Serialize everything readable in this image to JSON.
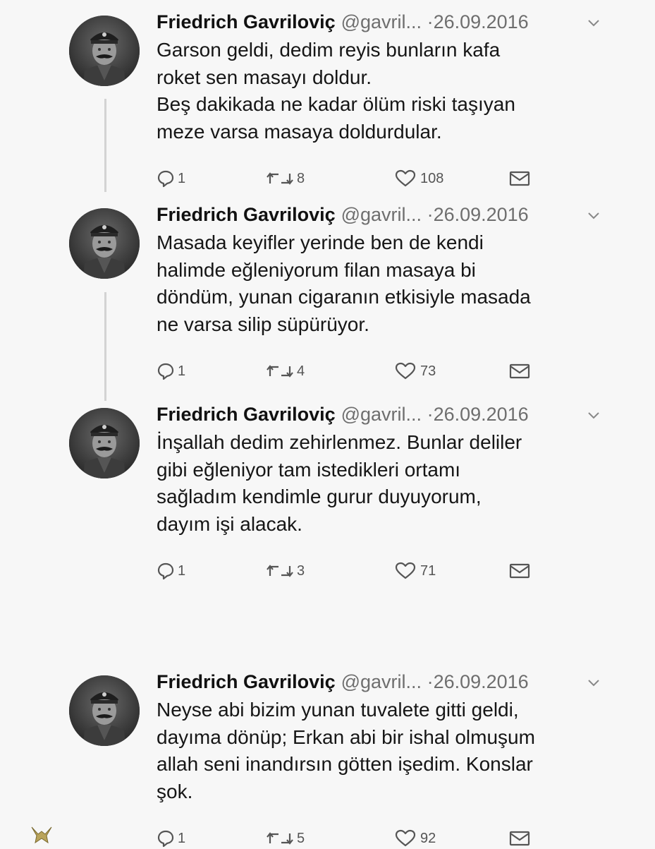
{
  "tweets": [
    {
      "author": "Friedrich Gavriloviç",
      "handle": "@gavril...",
      "separator": "·",
      "date": "26.09.2016",
      "lines": [
        "Garson geldi, dedim reyis bunların kafa",
        "roket sen masayı doldur.",
        "Beş dakikada ne kadar ölüm riski taşıyan",
        "meze varsa masaya doldurdular."
      ],
      "replies": "1",
      "retweets": "8",
      "likes": "108"
    },
    {
      "author": "Friedrich Gavriloviç",
      "handle": "@gavril...",
      "separator": "·",
      "date": "26.09.2016",
      "lines": [
        "Masada keyifler yerinde ben de kendi",
        "halimde eğleniyorum filan masaya bi",
        "döndüm, yunan cigaranın etkisiyle masada",
        "ne varsa silip süpürüyor."
      ],
      "replies": "1",
      "retweets": "4",
      "likes": "73"
    },
    {
      "author": "Friedrich Gavriloviç",
      "handle": "@gavril...",
      "separator": "·",
      "date": "26.09.2016",
      "lines": [
        "İnşallah dedim zehirlenmez. Bunlar deliler",
        "gibi eğleniyor tam istedikleri ortamı",
        "sağladım kendimle gurur duyuyorum,",
        "dayım işi alacak."
      ],
      "replies": "1",
      "retweets": "3",
      "likes": "71"
    },
    {
      "author": "Friedrich Gavriloviç",
      "handle": "@gavril...",
      "separator": "·",
      "date": "26.09.2016",
      "lines": [
        "Neyse abi bizim yunan tuvalete gitti geldi,",
        "dayıma dönüp; Erkan abi bir ishal olmuşum",
        "allah seni inandırsın götten işedim. Konslar",
        "şok."
      ],
      "replies": "1",
      "retweets": "5",
      "likes": "92"
    }
  ]
}
